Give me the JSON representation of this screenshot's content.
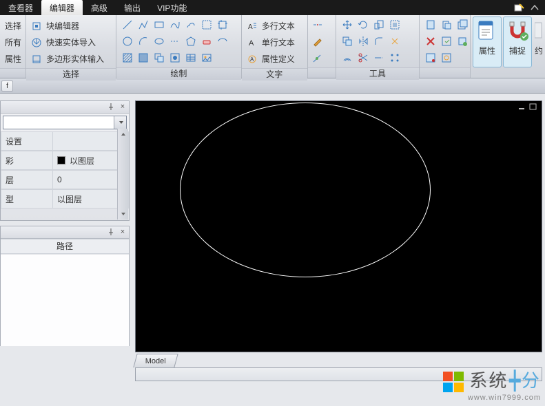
{
  "menubar": {
    "tabs": [
      "查看器",
      "编辑器",
      "高级",
      "输出",
      "VIP功能"
    ],
    "active_index": 1
  },
  "ribbon": {
    "group0": {
      "items": [
        "选择",
        "所有",
        "属性"
      ],
      "label": ""
    },
    "group1": {
      "items": [
        "块编辑器",
        "快速实体导入",
        "多边形实体输入"
      ],
      "label": "选择"
    },
    "group2": {
      "label": "绘制"
    },
    "group3": {
      "items": [
        "多行文本",
        "单行文本",
        "属性定义"
      ],
      "label": "文字"
    },
    "group4": {
      "label": ""
    },
    "group5": {
      "label": "工具"
    },
    "big_buttons": {
      "attr": "属性",
      "snap": "捕捉",
      "extra": "约"
    }
  },
  "palette1": {
    "header": "设置",
    "rows": [
      {
        "k": "彩",
        "v": "以图层",
        "swatch": "#000"
      },
      {
        "k": "层",
        "v": "0"
      },
      {
        "k": "型",
        "v": "以图层"
      }
    ]
  },
  "palette2": {
    "header": "路径"
  },
  "viewport": {
    "tab": "Model"
  },
  "watermark": {
    "brand_cn_a": "系统",
    "brand_cn_b": "分",
    "url": "www.win7999.com"
  },
  "strip": {
    "token": "f"
  }
}
